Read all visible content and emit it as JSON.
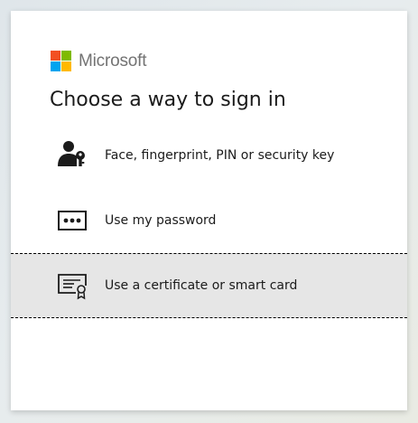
{
  "brand": {
    "name": "Microsoft",
    "logo_colors": [
      "#f25022",
      "#7fba00",
      "#00a4ef",
      "#ffb900"
    ]
  },
  "title": "Choose a way to sign in",
  "options": [
    {
      "label": "Face, fingerprint, PIN or security key",
      "icon": "user-key-icon"
    },
    {
      "label": "Use my password",
      "icon": "password-dots-icon"
    },
    {
      "label": "Use a certificate or smart card",
      "icon": "certificate-icon",
      "selected": true
    }
  ],
  "colors": {
    "text": "#1b1b1b",
    "brand_text": "#737373",
    "selected_bg": "#e6e6e6"
  }
}
